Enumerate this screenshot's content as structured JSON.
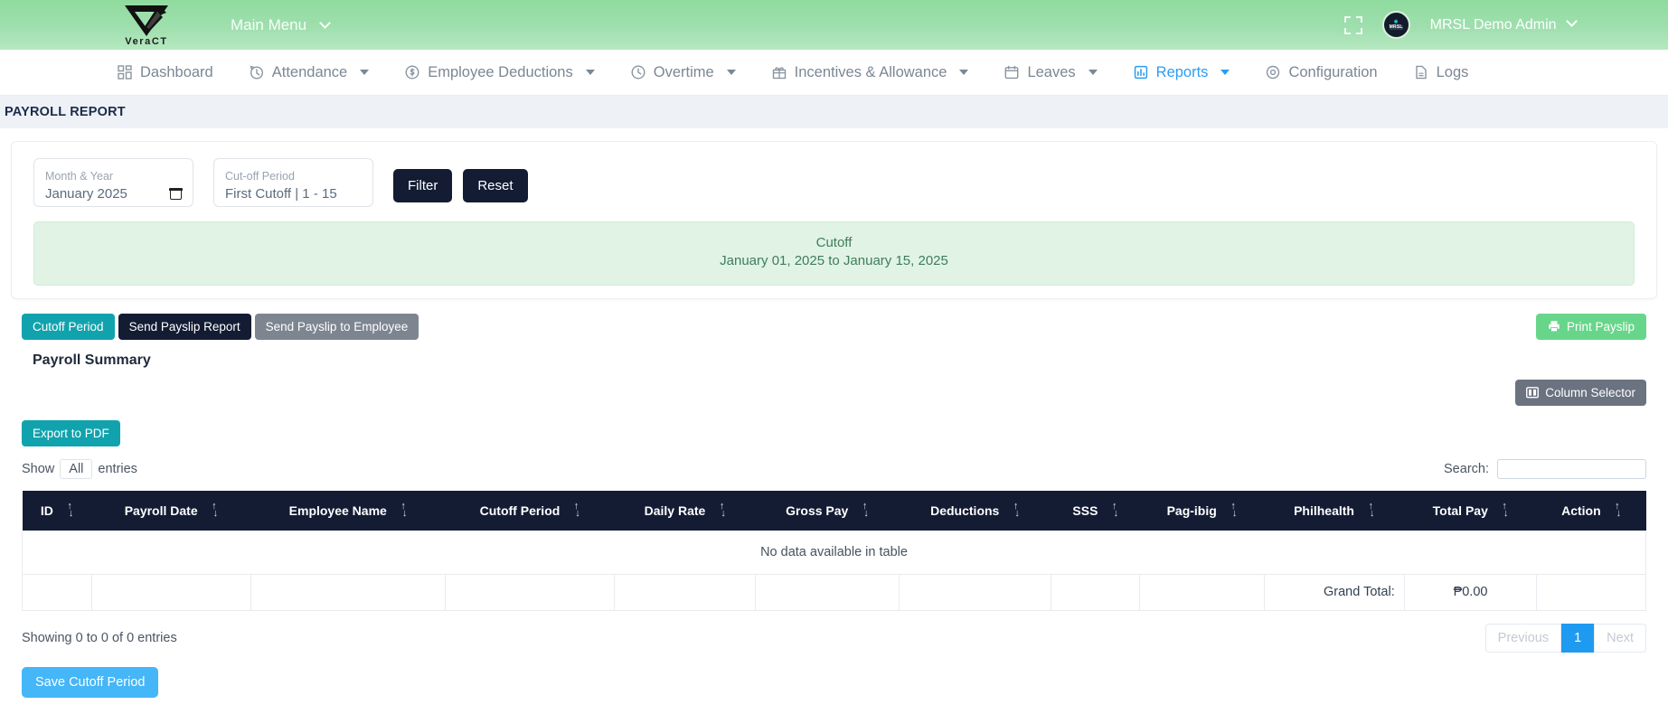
{
  "topbar": {
    "brand_name": "VeraCT",
    "main_menu_label": "Main Menu",
    "fullscreen_icon": "expand-icon",
    "user_name": "MRSL Demo Admin",
    "avatar_label": "MRSL"
  },
  "nav": {
    "items": [
      {
        "label": "Dashboard",
        "icon": "grid-icon",
        "caret": false,
        "active": false
      },
      {
        "label": "Attendance",
        "icon": "history-icon",
        "caret": true,
        "active": false
      },
      {
        "label": "Employee Deductions",
        "icon": "dollar-circle-icon",
        "caret": true,
        "active": false
      },
      {
        "label": "Overtime",
        "icon": "clock-icon",
        "caret": true,
        "active": false
      },
      {
        "label": "Incentives & Allowance",
        "icon": "gift-icon",
        "caret": true,
        "active": false
      },
      {
        "label": "Leaves",
        "icon": "calendar-icon",
        "caret": true,
        "active": false
      },
      {
        "label": "Reports",
        "icon": "chart-doc-icon",
        "caret": true,
        "active": true
      },
      {
        "label": "Configuration",
        "icon": "gear-icon",
        "caret": false,
        "active": false
      },
      {
        "label": "Logs",
        "icon": "file-icon",
        "caret": false,
        "active": false
      }
    ]
  },
  "page": {
    "title": "PAYROLL REPORT"
  },
  "filters": {
    "month_year": {
      "label": "Month & Year",
      "value": "January 2025",
      "icon": "calendar-icon"
    },
    "cutoff_period": {
      "label": "Cut-off Period",
      "value": "First Cutoff | 1 - 15"
    },
    "filter_button": "Filter",
    "reset_button": "Reset"
  },
  "cutoff_banner": {
    "title": "Cutoff",
    "range": "January 01, 2025 to January 15, 2025"
  },
  "actions": {
    "cutoff_period": "Cutoff Period",
    "send_payslip_report": "Send Payslip Report",
    "send_payslip_to_employee": "Send Payslip to Employee",
    "print_payslip": "Print Payslip",
    "print_icon": "printer-icon"
  },
  "summary": {
    "title": "Payroll Summary",
    "column_selector": "Column Selector",
    "column_selector_icon": "columns-icon",
    "export_pdf": "Export to PDF"
  },
  "table_controls": {
    "show_label": "Show",
    "length_value": "All",
    "entries_label": "entries",
    "search_label": "Search:",
    "search_value": "",
    "search_placeholder": ""
  },
  "table": {
    "columns": [
      "ID",
      "Payroll Date",
      "Employee Name",
      "Cutoff Period",
      "Daily Rate",
      "Gross Pay",
      "Deductions",
      "SSS",
      "Pag-ibig",
      "Philhealth",
      "Total Pay",
      "Action"
    ],
    "rows": [],
    "empty_message": "No data available in table",
    "footer": {
      "grand_total_label": "Grand Total:",
      "grand_total_value": "₱0.00"
    }
  },
  "footer": {
    "showing_text": "Showing 0 to 0 of 0 entries",
    "pagination": {
      "previous": "Previous",
      "pages": [
        "1"
      ],
      "next": "Next",
      "current": "1"
    },
    "save_button": "Save Cutoff Period"
  },
  "colors": {
    "header_green": "#9fdfae",
    "dark_navy": "#131c33",
    "teal": "#11a3ad",
    "accent_blue": "#2a9df4",
    "save_blue": "#45b6f7",
    "print_green": "#68d68a",
    "grey_button": "#7d8591"
  }
}
